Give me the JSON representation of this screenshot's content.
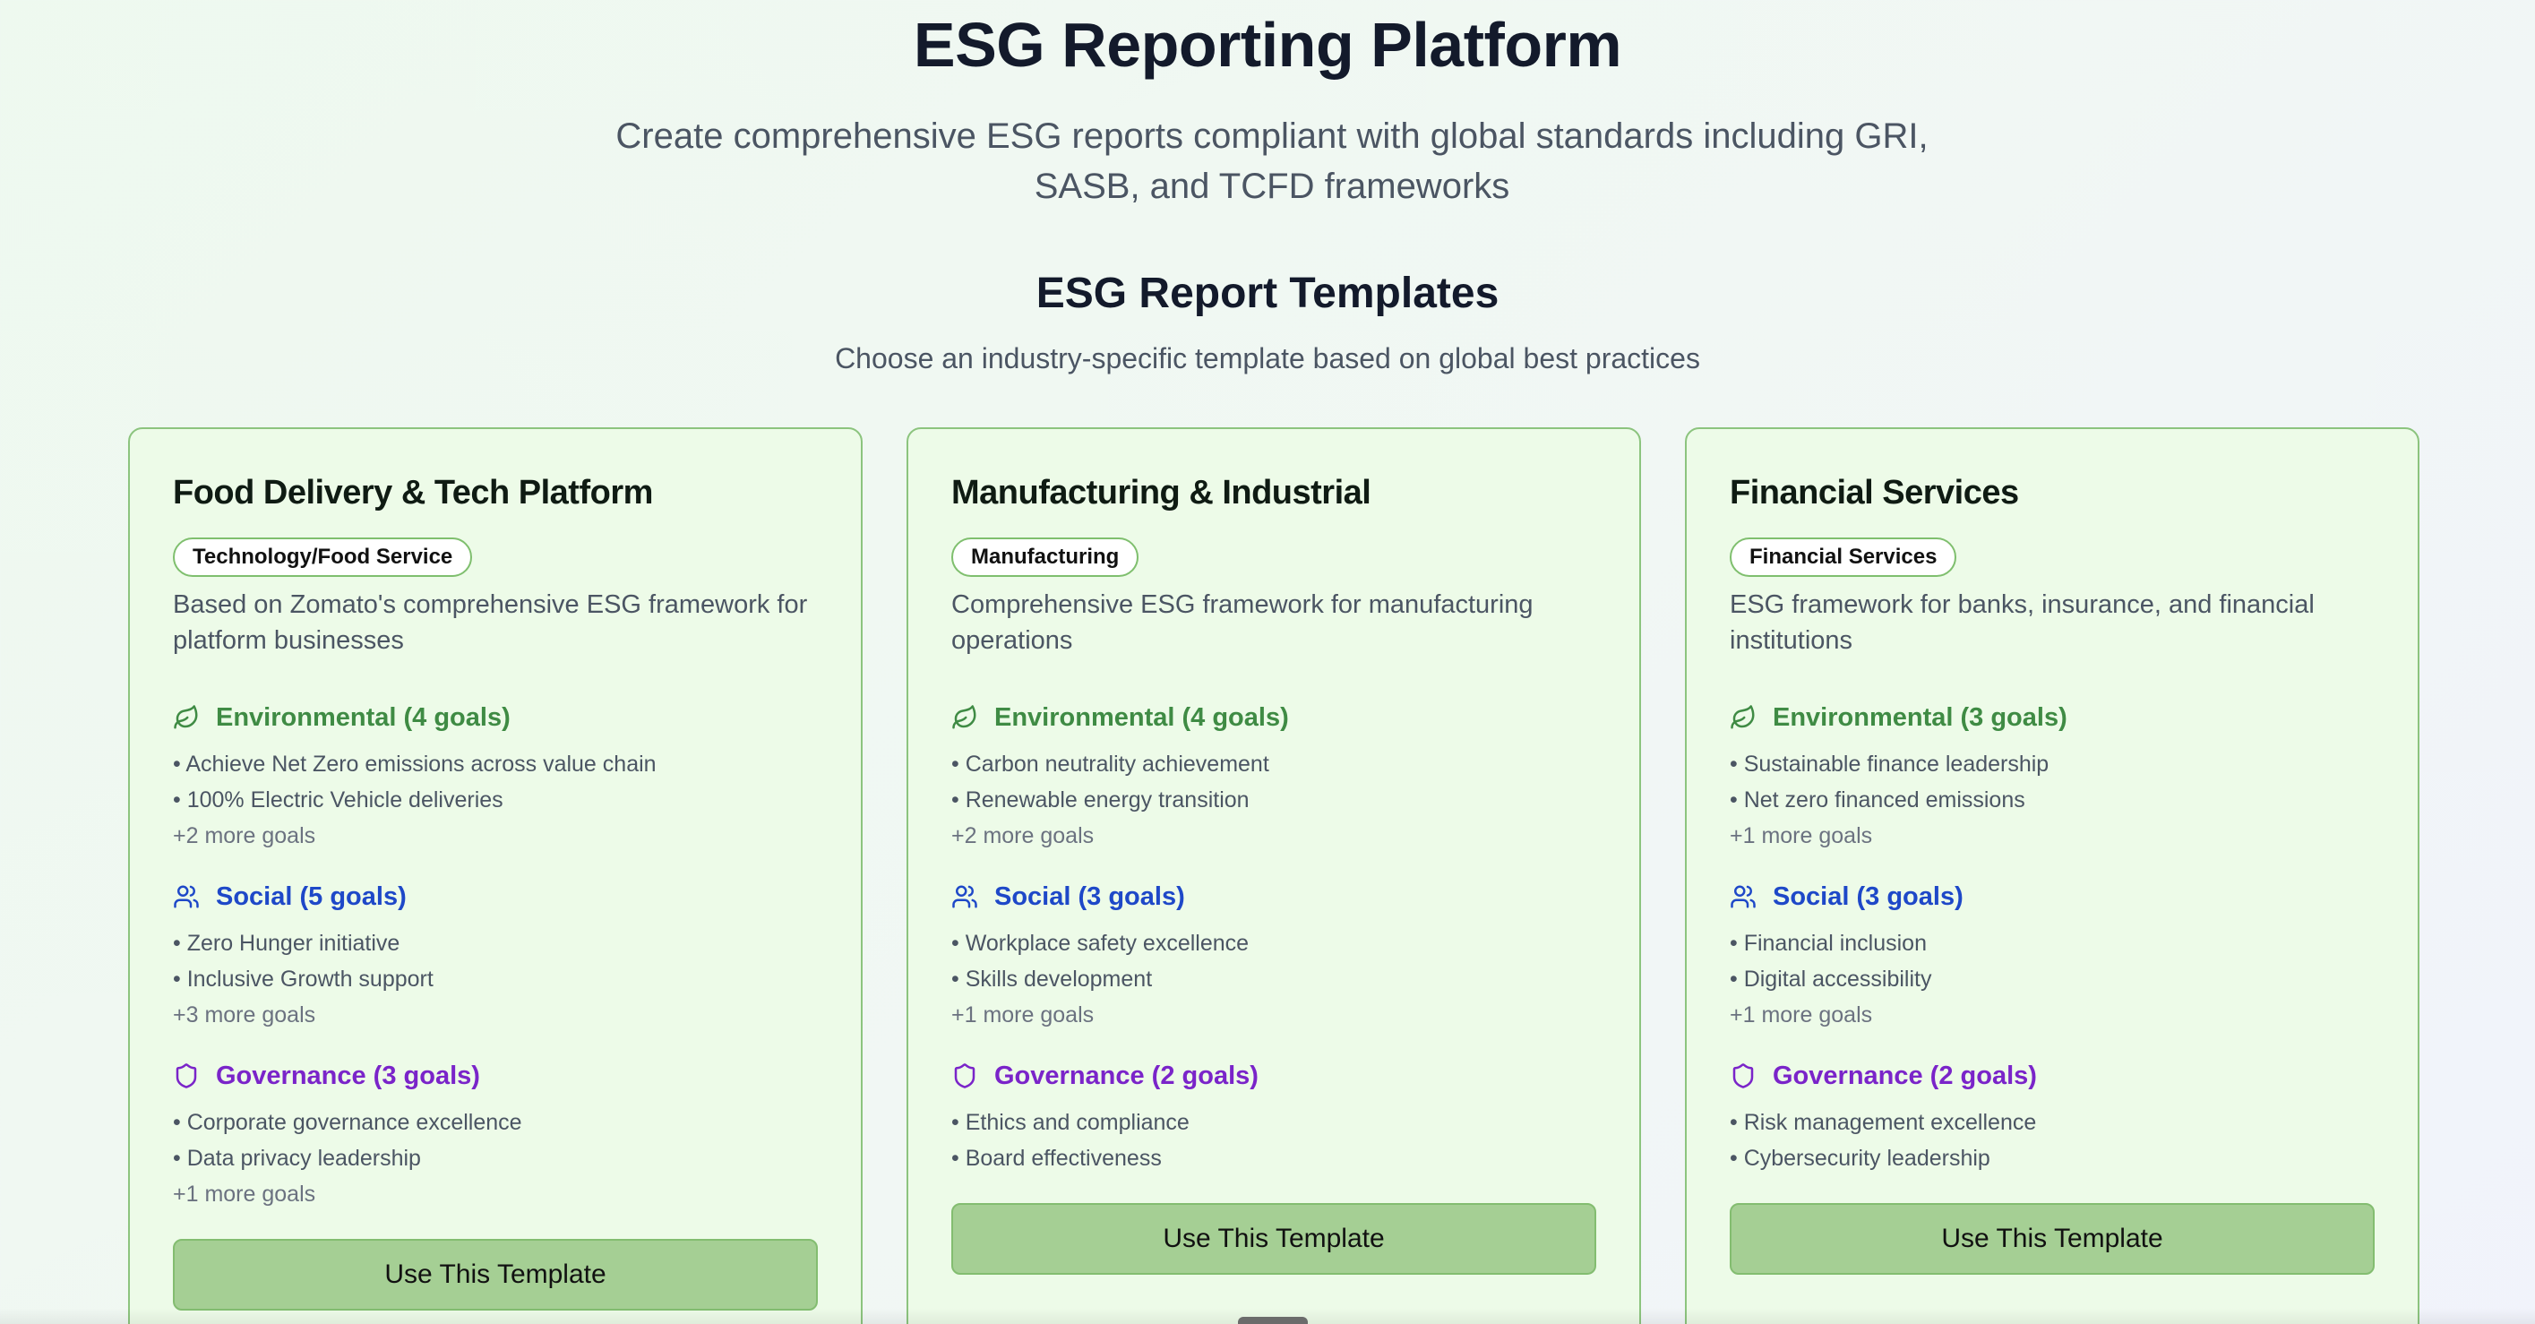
{
  "header": {
    "title": "ESG Reporting Platform",
    "subtitle": "Create comprehensive ESG reports compliant with global standards including GRI, SASB, and TCFD frameworks"
  },
  "templates_section": {
    "title": "ESG Report Templates",
    "subtitle": "Choose an industry-specific template based on global best practices"
  },
  "colors": {
    "environmental": "#3f8b44",
    "social": "#1e48c8",
    "governance": "#7a24c9",
    "card_bg": "#edfbe8",
    "button_bg": "#a5cf94"
  },
  "cards": [
    {
      "title": "Food Delivery & Tech Platform",
      "badge": "Technology/Food Service",
      "description": "Based on Zomato's comprehensive ESG framework for platform businesses",
      "environmental": {
        "icon": "leaf-icon",
        "label": "Environmental (4 goals)",
        "goals": [
          "• Achieve Net Zero emissions across value chain",
          "• 100% Electric Vehicle deliveries"
        ],
        "more": "+2 more goals"
      },
      "social": {
        "icon": "users-icon",
        "label": "Social (5 goals)",
        "goals": [
          "• Zero Hunger initiative",
          "• Inclusive Growth support"
        ],
        "more": "+3 more goals"
      },
      "governance": {
        "icon": "shield-icon",
        "label": "Governance (3 goals)",
        "goals": [
          "• Corporate governance excellence",
          "• Data privacy leadership"
        ],
        "more": "+1 more goals"
      },
      "button": "Use This Template"
    },
    {
      "title": "Manufacturing & Industrial",
      "badge": "Manufacturing",
      "description": "Comprehensive ESG framework for manufacturing operations",
      "environmental": {
        "icon": "leaf-icon",
        "label": "Environmental (4 goals)",
        "goals": [
          "• Carbon neutrality achievement",
          "• Renewable energy transition"
        ],
        "more": "+2 more goals"
      },
      "social": {
        "icon": "users-icon",
        "label": "Social (3 goals)",
        "goals": [
          "• Workplace safety excellence",
          "• Skills development"
        ],
        "more": "+1 more goals"
      },
      "governance": {
        "icon": "shield-icon",
        "label": "Governance (2 goals)",
        "goals": [
          "• Ethics and compliance",
          "• Board effectiveness"
        ],
        "more": ""
      },
      "button": "Use This Template"
    },
    {
      "title": "Financial Services",
      "badge": "Financial Services",
      "description": "ESG framework for banks, insurance, and financial institutions",
      "environmental": {
        "icon": "leaf-icon",
        "label": "Environmental (3 goals)",
        "goals": [
          "• Sustainable finance leadership",
          "• Net zero financed emissions"
        ],
        "more": "+1 more goals"
      },
      "social": {
        "icon": "users-icon",
        "label": "Social (3 goals)",
        "goals": [
          "• Financial inclusion",
          "• Digital accessibility"
        ],
        "more": "+1 more goals"
      },
      "governance": {
        "icon": "shield-icon",
        "label": "Governance (2 goals)",
        "goals": [
          "• Risk management excellence",
          "• Cybersecurity leadership"
        ],
        "more": ""
      },
      "button": "Use This Template"
    }
  ]
}
